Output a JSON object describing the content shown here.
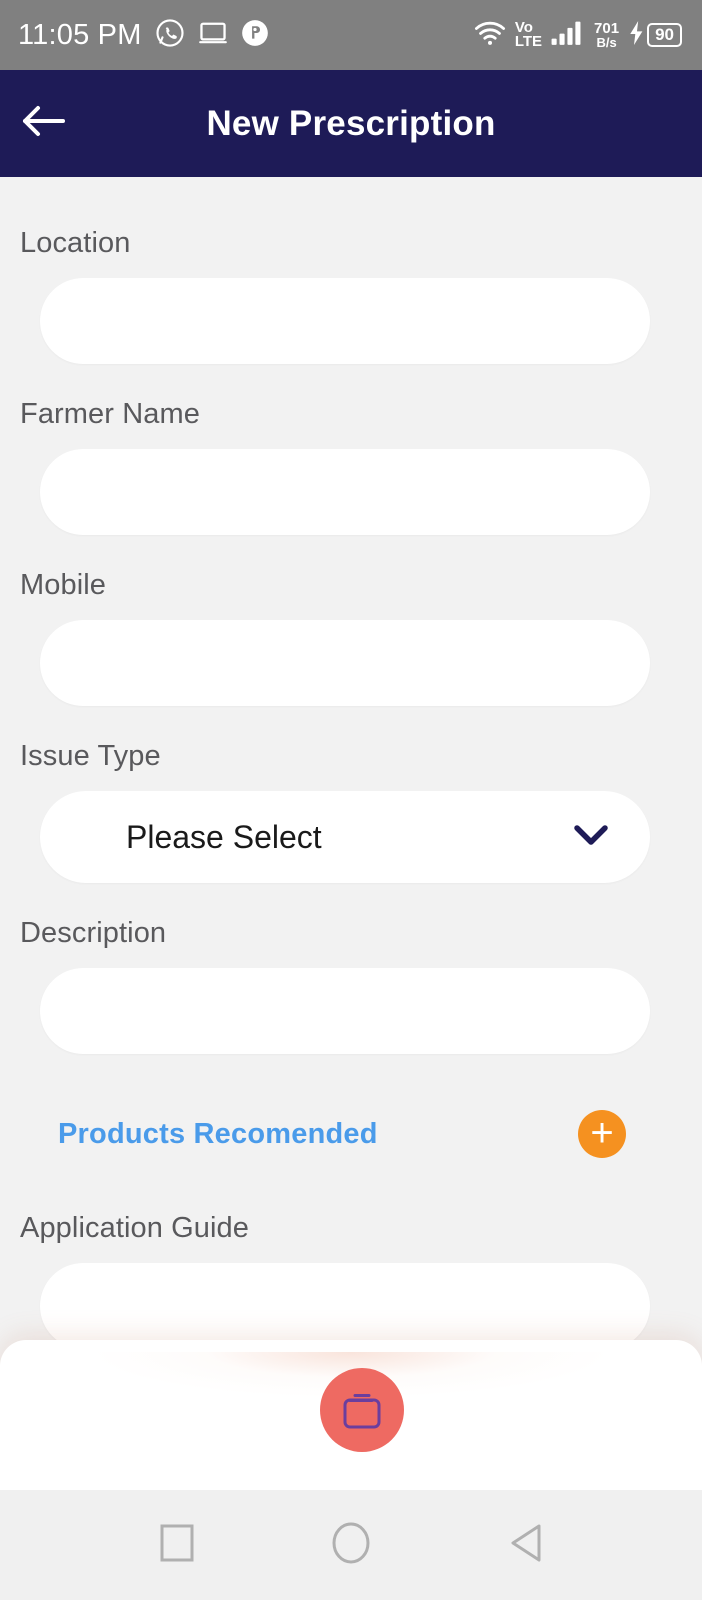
{
  "status_bar": {
    "time": "11:05 PM",
    "icons_left": [
      "whatsapp-icon",
      "cast-screen-icon",
      "app-circle-icon"
    ],
    "network_type": {
      "line1": "Vo",
      "line2": "LTE"
    },
    "net_speed": {
      "value": "701",
      "unit": "B/s"
    },
    "battery_level": "90",
    "charging": true,
    "background_color": "#808080"
  },
  "app_bar": {
    "title": "New Prescription",
    "back_icon": "arrow-left-icon",
    "background_color": "#1e1b57"
  },
  "form": {
    "fields": [
      {
        "label": "Location",
        "value": "",
        "placeholder": "",
        "type": "text"
      },
      {
        "label": "Farmer Name",
        "value": "",
        "placeholder": "",
        "type": "text"
      },
      {
        "label": "Mobile",
        "value": "",
        "placeholder": "",
        "type": "tel"
      },
      {
        "label": "Issue Type",
        "value": "Please Select",
        "type": "dropdown"
      },
      {
        "label": "Description",
        "value": "",
        "placeholder": "",
        "type": "text"
      },
      {
        "label": "Application Guide",
        "value": "",
        "placeholder": "",
        "type": "text"
      }
    ]
  },
  "products_section": {
    "link_label": "Products Recomended",
    "link_color": "#4a9bea",
    "add_button_icon": "plus-icon",
    "add_button_color": "#f59120"
  },
  "fab": {
    "icon": "document-card-icon",
    "background_color": "#ee6a62",
    "icon_color": "#6b3e9e"
  },
  "nav_bar": {
    "buttons": [
      {
        "name": "recents",
        "icon": "square-icon"
      },
      {
        "name": "home",
        "icon": "circle-icon"
      },
      {
        "name": "back",
        "icon": "triangle-left-icon"
      }
    ]
  }
}
